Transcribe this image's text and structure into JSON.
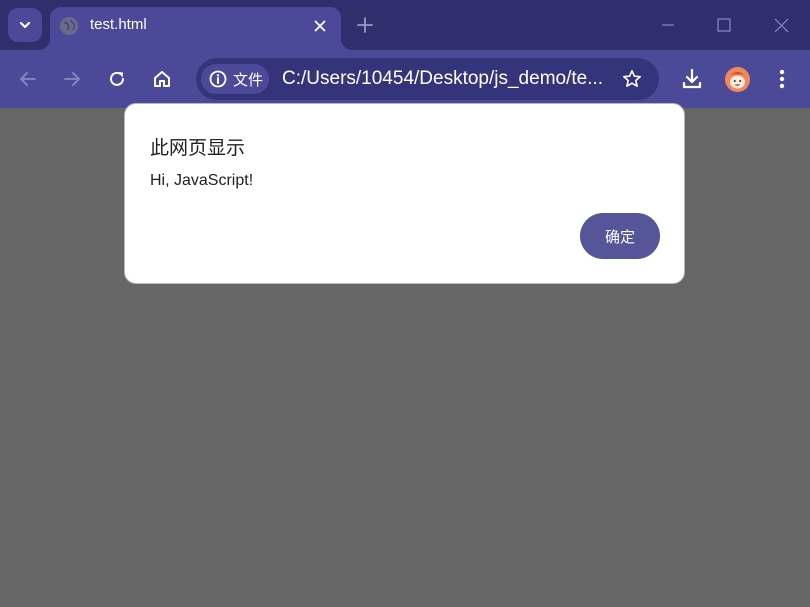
{
  "colors": {
    "tabstrip_bg": "#2f2f6e",
    "toolbar_bg": "#4a4a98",
    "omnibox_bg": "#34347a",
    "page_overlay": "#666666",
    "dialog_bg": "#ffffff",
    "ok_button_bg": "#55559a"
  },
  "tab": {
    "title": "test.html",
    "favicon": "globe-icon"
  },
  "address_bar": {
    "site_info_label": "文件",
    "url": "C:/Users/10454/Desktop/js_demo/te..."
  },
  "icons": {
    "tab_search": "chevron-down-icon",
    "tab_close": "close-icon",
    "new_tab": "plus-icon",
    "minimize": "minimize-icon",
    "maximize": "maximize-icon",
    "close_window": "close-icon",
    "back": "arrow-left-icon",
    "forward": "arrow-right-icon",
    "reload": "reload-icon",
    "home": "home-icon",
    "site_info": "info-icon",
    "bookmark": "star-icon",
    "downloads": "download-icon",
    "profile": "avatar",
    "menu": "more-vert-icon"
  },
  "dialog": {
    "title": "此网页显示",
    "message": "Hi, JavaScript!",
    "ok_label": "确定"
  }
}
